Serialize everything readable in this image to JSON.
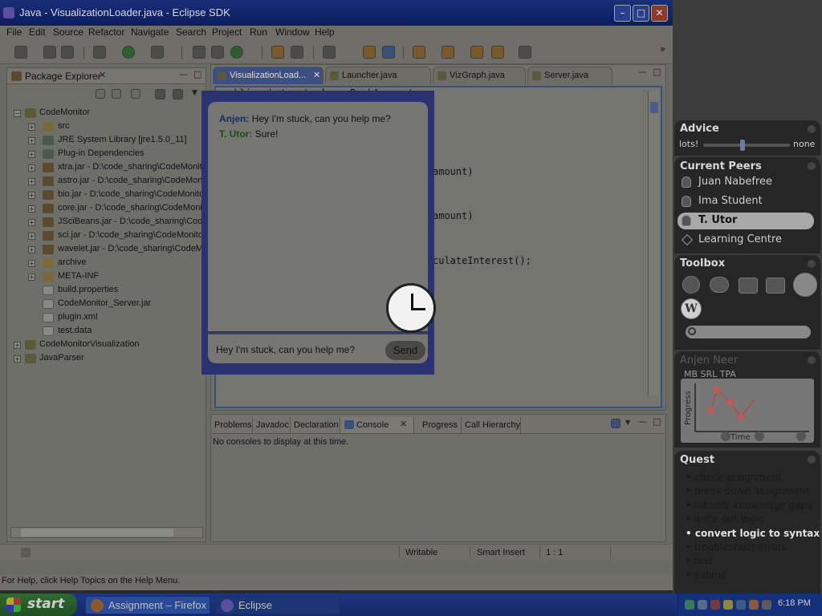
{
  "window": {
    "title": "Java - VisualizationLoader.java - Eclipse SDK"
  },
  "menu": [
    "File",
    "Edit",
    "Source",
    "Refactor",
    "Navigate",
    "Search",
    "Project",
    "Run",
    "Window",
    "Help"
  ],
  "package_explorer": {
    "title": "Package Explorer",
    "items": [
      {
        "label": "CodeMonitor",
        "type": "proj"
      },
      {
        "label": "src",
        "type": "folder"
      },
      {
        "label": "JRE System Library [jre1.5.0_11]",
        "type": "lib"
      },
      {
        "label": "Plug-in Dependencies",
        "type": "lib"
      },
      {
        "label": "xtra.jar - D:\\code_sharing\\CodeMonit",
        "type": "jar"
      },
      {
        "label": "astro.jar - D:\\code_sharing\\CodeMon",
        "type": "jar"
      },
      {
        "label": "bio.jar - D:\\code_sharing\\CodeMonito",
        "type": "jar"
      },
      {
        "label": "core.jar - D:\\code_sharing\\CodeMonit",
        "type": "jar"
      },
      {
        "label": "JSciBeans.jar - D:\\code_sharing\\Code",
        "type": "jar"
      },
      {
        "label": "sci.jar - D:\\code_sharing\\CodeMonito",
        "type": "jar"
      },
      {
        "label": "wavelet.jar - D:\\code_sharing\\CodeM",
        "type": "jar"
      },
      {
        "label": "archive",
        "type": "folder"
      },
      {
        "label": "META-INF",
        "type": "folder"
      },
      {
        "label": "build.properties",
        "type": "file"
      },
      {
        "label": "CodeMonitor_Server.jar",
        "type": "file"
      },
      {
        "label": "plugin.xml",
        "type": "file"
      },
      {
        "label": "test.data",
        "type": "file"
      },
      {
        "label": "CodeMonitorVisualization",
        "type": "proj"
      },
      {
        "label": "JavaParser",
        "type": "proj"
      }
    ]
  },
  "editor": {
    "tabs": [
      "VisualizationLoad...",
      "Launcher.java",
      "VizGraph.java",
      "Server.java"
    ],
    "code": [
      "public abstract class BankAccount",
      "amount)",
      "amount)",
      "culateInterest();"
    ]
  },
  "console": {
    "tabs": [
      "Problems",
      "Javadoc",
      "Declaration",
      "Console",
      "Progress",
      "Call Hierarchy"
    ],
    "message": "No consoles to display at this time."
  },
  "status": {
    "writable": "Writable",
    "insert": "Smart Insert",
    "position": "1 : 1"
  },
  "help_bar": "For Help, click Help Topics on the Help Menu.",
  "chat": {
    "messages": [
      {
        "sender": "Anjen:",
        "text": " Hey I'm stuck, can you help me?"
      },
      {
        "sender": "T. Utor:",
        "text": " Sure!"
      }
    ],
    "input": "Hey I'm stuck, can you help me?",
    "send_label": "Send"
  },
  "side_panel": {
    "advice": {
      "title": "Advice",
      "left": "lots!",
      "right": "none",
      "level": 0.45
    },
    "peers": {
      "title": "Current Peers",
      "items": [
        {
          "name": "Juan Nabefree",
          "selected": false
        },
        {
          "name": "Ima Student",
          "selected": false
        },
        {
          "name": "T. Utor",
          "selected": true
        },
        {
          "name": "Learning Centre",
          "selected": false
        }
      ]
    },
    "toolbox": {
      "title": "Toolbox"
    },
    "progress": {
      "name": "Anjen Neer",
      "tabs": "MB SRL TPA",
      "ylabel": "Progress",
      "xlabel": "Time"
    },
    "quest": {
      "title": "Quest",
      "items": [
        "check assignment",
        "break down assignment",
        "identify knowledge gaps",
        "write out logic",
        "convert logic to syntax",
        "troubleshoot errors",
        "test",
        "submit"
      ],
      "current": 4
    }
  },
  "taskbar": {
    "start": "start",
    "tasks": [
      "Assignment – Firefox",
      "Eclipse"
    ],
    "time": "6:18 PM"
  }
}
